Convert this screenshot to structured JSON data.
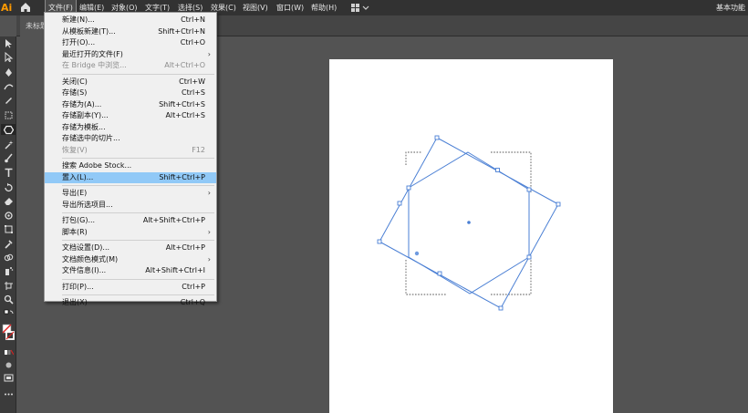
{
  "app": {
    "logo": "Ai",
    "workspace": "基本功能"
  },
  "menubar": [
    {
      "label": "文件(F)",
      "active": true
    },
    {
      "label": "编辑(E)"
    },
    {
      "label": "对象(O)"
    },
    {
      "label": "文字(T)"
    },
    {
      "label": "选择(S)"
    },
    {
      "label": "效果(C)"
    },
    {
      "label": "视图(V)"
    },
    {
      "label": "窗口(W)"
    },
    {
      "label": "帮助(H)"
    }
  ],
  "document_tab": "未标题",
  "file_menu": [
    {
      "label": "新建(N)...",
      "shortcut": "Ctrl+N"
    },
    {
      "label": "从模板新建(T)...",
      "shortcut": "Shift+Ctrl+N"
    },
    {
      "label": "打开(O)...",
      "shortcut": "Ctrl+O"
    },
    {
      "label": "最近打开的文件(F)",
      "shortcut": "",
      "submenu": true
    },
    {
      "label": "在 Bridge 中浏览...",
      "shortcut": "Alt+Ctrl+O",
      "disabled": true
    },
    {
      "separator": true
    },
    {
      "label": "关闭(C)",
      "shortcut": "Ctrl+W"
    },
    {
      "label": "存储(S)",
      "shortcut": "Ctrl+S"
    },
    {
      "label": "存储为(A)...",
      "shortcut": "Shift+Ctrl+S"
    },
    {
      "label": "存储副本(Y)...",
      "shortcut": "Alt+Ctrl+S"
    },
    {
      "label": "存储为模板...",
      "shortcut": ""
    },
    {
      "label": "存储选中的切片...",
      "shortcut": ""
    },
    {
      "label": "恢复(V)",
      "shortcut": "F12",
      "disabled": true
    },
    {
      "separator": true
    },
    {
      "label": "搜索 Adobe Stock...",
      "shortcut": ""
    },
    {
      "label": "置入(L)...",
      "shortcut": "Shift+Ctrl+P",
      "highlighted": true
    },
    {
      "separator": true
    },
    {
      "label": "导出(E)",
      "shortcut": "",
      "submenu": true
    },
    {
      "label": "导出所选项目...",
      "shortcut": ""
    },
    {
      "separator": true
    },
    {
      "label": "打包(G)...",
      "shortcut": "Alt+Shift+Ctrl+P"
    },
    {
      "label": "脚本(R)",
      "shortcut": "",
      "submenu": true
    },
    {
      "separator": true
    },
    {
      "label": "文档设置(D)...",
      "shortcut": "Alt+Ctrl+P"
    },
    {
      "label": "文档颜色模式(M)",
      "shortcut": "",
      "submenu": true
    },
    {
      "label": "文件信息(I)...",
      "shortcut": "Alt+Shift+Ctrl+I"
    },
    {
      "separator": true
    },
    {
      "label": "打印(P)...",
      "shortcut": "Ctrl+P"
    },
    {
      "separator": true
    },
    {
      "label": "退出(X)",
      "shortcut": "Ctrl+Q"
    }
  ],
  "tools": [
    "selection-tool",
    "direct-selection-tool",
    "pen-tool",
    "curvature-tool",
    "pencil-tool",
    "type-touch-tool",
    "polygon-tool",
    "magic-wand-tool",
    "paintbrush-tool",
    "type-tool",
    "rotate-tool",
    "eraser-tool",
    "warp-tool",
    "free-transform-tool",
    "shape-builder-tool",
    "eyedropper-tool",
    "blend-tool",
    "symbol-sprayer-tool",
    "artboard-tool",
    "slice-tool",
    "zoom-tool",
    "hand-tool"
  ],
  "colors": {
    "accent": "#91c9f7",
    "selection": "#4a7fd4",
    "logo": "#ff9a00"
  }
}
